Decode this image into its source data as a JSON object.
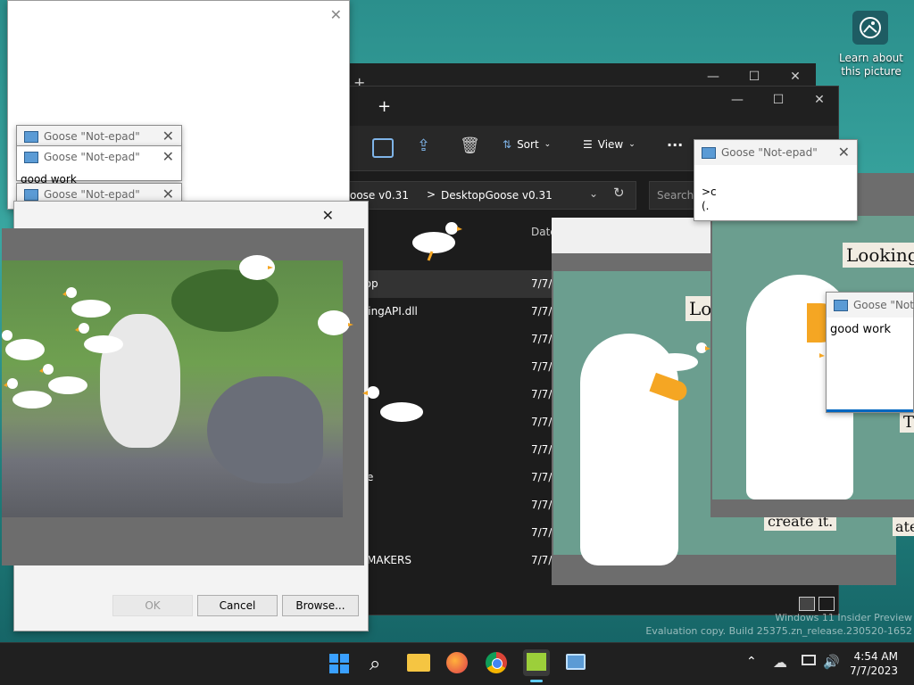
{
  "desktop": {
    "learn_label": "Learn about this picture",
    "watermark_line1": "Windows 11 Insider Preview",
    "watermark_line2": "Evaluation copy. Build 25375.zn_release.230520-1652"
  },
  "explorer": {
    "new_tab": "+",
    "sort_label": "Sort",
    "view_label": "View",
    "more_label": "···",
    "path_part1": "oose v0.31",
    "path_sep": ">",
    "path_part2": "DesktopGoose v0.31",
    "search_placeholder": "Search D",
    "date_header": "Date",
    "rows": [
      {
        "name": "ktop",
        "date": "7/7/"
      },
      {
        "name": "ddingAPI.dll",
        "date": "7/7/"
      },
      {
        "name": "",
        "date": "7/7/"
      },
      {
        "name": "",
        "date": "7/7/"
      },
      {
        "name": "",
        "date": "7/7/"
      },
      {
        "name": "",
        "date": "7/7/"
      },
      {
        "name": "",
        "date": "7/7/"
      },
      {
        "name": "e",
        "date": "7/7/"
      },
      {
        "name": "",
        "date": "7/7/"
      },
      {
        "name": "",
        "date": "7/7/"
      },
      {
        "name": "MAKERS",
        "date": "7/7/"
      }
    ]
  },
  "notepads": {
    "title": "Goose \"Not-epad\"",
    "title_short": "Goose \"Not-e",
    "text": "good work",
    "text_partial": ">c (."
  },
  "dialog": {
    "ok_label": "OK",
    "cancel_label": "Cancel",
    "browse_label": "Browse..."
  },
  "memes": {
    "looking_label": "Looking",
    "lo_label": "Lo",
    "create_label": "create it.",
    "t_label": "T",
    "ate_label": "ate"
  },
  "taskbar": {
    "time": "4:54 AM",
    "date": "7/7/2023"
  },
  "colors": {
    "accent": "#0067c0",
    "taskbar": "#202020",
    "goose_orange": "#f5a623"
  }
}
